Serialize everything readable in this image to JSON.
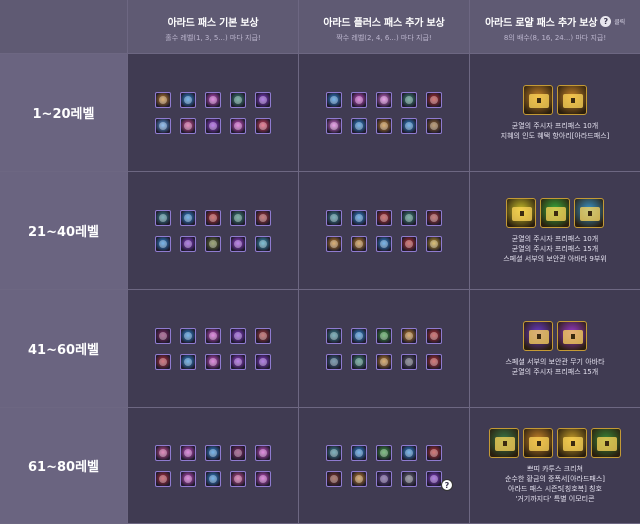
{
  "headers": {
    "basic": {
      "title": "아라드 패스 기본 보상",
      "sub": "홀수 레벨(1, 3, 5...) 마다 지급!"
    },
    "plus": {
      "title": "아라드 플러스 패스 추가 보상",
      "sub": "짝수 레벨(2, 4, 6...) 마다 지급!"
    },
    "royal": {
      "title": "아라드 로얄 패스 추가 보상",
      "sub": "8의 배수(8, 16, 24...) 마다 지급!",
      "help_icon": "?",
      "help_label": "클릭"
    }
  },
  "rows": [
    {
      "level": "1~20레벨",
      "basic_colors": [
        "#c9862a",
        "#2f8ee0",
        "#d24fd1",
        "#3a8c7a",
        "#8a3bd9",
        "#5aa0e8",
        "#d94f9a",
        "#9b3fe0",
        "#d94fd1",
        "#e04060"
      ],
      "plus_colors": [
        "#2f8ee0",
        "#d24fd1",
        "#e070e0",
        "#3a8c7a",
        "#c03030",
        "#e070e0",
        "#2f8ee0",
        "#c9862a",
        "#2f8ee0",
        "#9a6a30"
      ],
      "royal_chest_colors": [
        "#c9862a",
        "#c9862a"
      ],
      "royal_lines": [
        "균열의 주시자 프리패스 10개",
        "지혜의 인도 혜택 항아리[아라드패스]"
      ]
    },
    {
      "level": "21~40레벨",
      "basic_colors": [
        "#3a8c9a",
        "#2f8ee0",
        "#c03030",
        "#3a8c7a",
        "#b03a3a",
        "#2f8ee0",
        "#8a3bd9",
        "#6a7a30",
        "#9b3fe0",
        "#3aa0c0"
      ],
      "plus_colors": [
        "#3a8c9a",
        "#2f8ee0",
        "#c03030",
        "#3a8c7a",
        "#b03a3a",
        "#c9862a",
        "#c9862a",
        "#2f8ee0",
        "#c03030",
        "#c9a02a"
      ],
      "royal_chest_colors": [
        "#c9c02a",
        "#3ab040",
        "#3a9ad0"
      ],
      "royal_lines": [
        "균열의 주시자 프리패스 10개",
        "균열의 주시자 프리패스 15개",
        "스페셜 서부의 보안관 아바타 9부위"
      ]
    },
    {
      "level": "41~60레벨",
      "basic_colors": [
        "#8a2a6a",
        "#2f8ee0",
        "#d24fd1",
        "#8a3bd9",
        "#b03a3a",
        "#c03040",
        "#2f8ee0",
        "#d24fd1",
        "#9b3fe0",
        "#8a3bd9"
      ],
      "plus_colors": [
        "#3a8c9a",
        "#2f8ee0",
        "#3aa040",
        "#c9862a",
        "#c03030",
        "#3a6a8a",
        "#3a8c7a",
        "#c9862a",
        "#5a5a6a",
        "#c03030"
      ],
      "royal_chest_colors": [
        "#6a3ad0",
        "#9a3ad0"
      ],
      "royal_lines": [
        "스페셜 서부의 보안관 무기 아바타",
        "균열의 주시자 프리패스 15개"
      ]
    },
    {
      "level": "61~80레벨",
      "basic_colors": [
        "#d24f9a",
        "#d24fd1",
        "#2f8ee0",
        "#8a2a6a",
        "#d24fd1",
        "#c03040",
        "#d24fd1",
        "#2f8ee0",
        "#d24f9a",
        "#d24fd1"
      ],
      "plus_colors": [
        "#3a8c9a",
        "#2f8ee0",
        "#3aa040",
        "#2f8ee0",
        "#c03030",
        "#8a3a2a",
        "#c9862a",
        "#6a4a9a",
        "#6a6a7a",
        "#8a3bd9"
      ],
      "plus_help_icon": "?",
      "royal_chest_colors": [
        "#3a7a4a",
        "#c9862a",
        "#c9a02a",
        "#3a8a3a"
      ],
      "royal_lines": [
        "쁘띠 카투스 크리쳐",
        "순수한 황금의 증폭서[아라드패스]",
        "아라드 패스 시즌5[칭호복] 칭호",
        "'거기까지다' 특별 이모티콘"
      ]
    }
  ]
}
